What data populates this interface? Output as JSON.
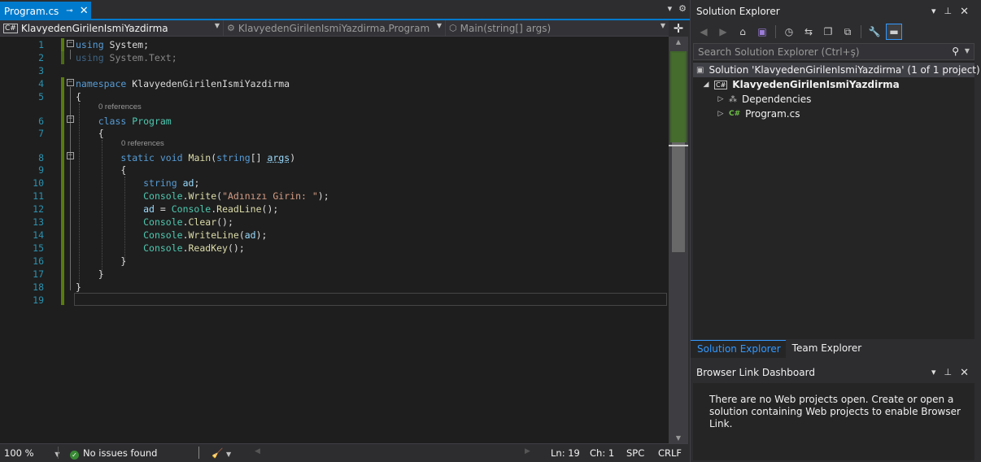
{
  "editor": {
    "tab": {
      "title": "Program.cs",
      "pin_glyph": "⊸",
      "close_glyph": "✕"
    },
    "tab_strip_glyphs": {
      "overflow": "▾",
      "settings": "⚙"
    },
    "nav": {
      "project": "KlavyedenGirilenIsmiYazdirma",
      "class": "KlavyedenGirilenIsmiYazdirma.Program",
      "member": "Main(string[] args)"
    },
    "codelens": "0 references",
    "lines": [
      {
        "n": "1",
        "tokens": [
          [
            "kw",
            "using"
          ],
          [
            "",
            " System;"
          ]
        ]
      },
      {
        "n": "2",
        "tokens": [
          [
            "kw faded",
            "using"
          ],
          [
            "faded",
            " System.Text;"
          ]
        ]
      },
      {
        "n": "3",
        "tokens": []
      },
      {
        "n": "4",
        "tokens": [
          [
            "kw",
            "namespace"
          ],
          [
            "",
            " KlavyedenGirilenIsmiYazdirma"
          ]
        ]
      },
      {
        "n": "5",
        "tokens": [
          [
            "",
            "{"
          ]
        ]
      },
      {
        "n": "6",
        "tokens": [
          [
            "",
            "    "
          ],
          [
            "kw",
            "class"
          ],
          [
            "",
            " "
          ],
          [
            "ty",
            "Program"
          ]
        ]
      },
      {
        "n": "7",
        "tokens": [
          [
            "",
            "    {"
          ]
        ]
      },
      {
        "n": "8",
        "tokens": [
          [
            "",
            "        "
          ],
          [
            "kw",
            "static"
          ],
          [
            "",
            " "
          ],
          [
            "kw",
            "void"
          ],
          [
            "",
            " "
          ],
          [
            "mt",
            "Main"
          ],
          [
            "",
            "("
          ],
          [
            "kw",
            "string"
          ],
          [
            "",
            "[] "
          ],
          [
            "pm",
            "args"
          ],
          [
            "",
            ")"
          ]
        ]
      },
      {
        "n": "9",
        "tokens": [
          [
            "",
            "        {"
          ]
        ]
      },
      {
        "n": "10",
        "tokens": [
          [
            "",
            "            "
          ],
          [
            "kw",
            "string"
          ],
          [
            "",
            " "
          ],
          [
            "vr",
            "ad"
          ],
          [
            "",
            ";"
          ]
        ]
      },
      {
        "n": "11",
        "tokens": [
          [
            "",
            "            "
          ],
          [
            "ty",
            "Console"
          ],
          [
            "",
            "."
          ],
          [
            "mt",
            "Write"
          ],
          [
            "",
            "("
          ],
          [
            "str",
            "\"Adınızı Girin: \""
          ],
          [
            "",
            ");"
          ]
        ]
      },
      {
        "n": "12",
        "tokens": [
          [
            "",
            "            "
          ],
          [
            "vr",
            "ad"
          ],
          [
            "",
            " = "
          ],
          [
            "ty",
            "Console"
          ],
          [
            "",
            "."
          ],
          [
            "mt",
            "ReadLine"
          ],
          [
            "",
            "();"
          ]
        ]
      },
      {
        "n": "13",
        "tokens": [
          [
            "",
            "            "
          ],
          [
            "ty",
            "Console"
          ],
          [
            "",
            "."
          ],
          [
            "mt",
            "Clear"
          ],
          [
            "",
            "();"
          ]
        ]
      },
      {
        "n": "14",
        "tokens": [
          [
            "",
            "            "
          ],
          [
            "ty",
            "Console"
          ],
          [
            "",
            "."
          ],
          [
            "mt",
            "WriteLine"
          ],
          [
            "",
            "("
          ],
          [
            "vr",
            "ad"
          ],
          [
            "",
            ");"
          ]
        ]
      },
      {
        "n": "15",
        "tokens": [
          [
            "",
            "            "
          ],
          [
            "ty",
            "Console"
          ],
          [
            "",
            "."
          ],
          [
            "mt",
            "ReadKey"
          ],
          [
            "",
            "();"
          ]
        ]
      },
      {
        "n": "16",
        "tokens": [
          [
            "",
            "        }"
          ]
        ]
      },
      {
        "n": "17",
        "tokens": [
          [
            "",
            "    }"
          ]
        ]
      },
      {
        "n": "18",
        "tokens": [
          [
            "",
            "}"
          ]
        ]
      },
      {
        "n": "19",
        "tokens": []
      }
    ],
    "status": {
      "zoom": "100 %",
      "issues": "No issues found",
      "line": "Ln: 19",
      "col": "Ch: 1",
      "whitespace": "SPC",
      "eol": "CRLF"
    }
  },
  "solution_explorer": {
    "title": "Solution Explorer",
    "search_placeholder": "Search Solution Explorer (Ctrl+ş)",
    "solution": "Solution 'KlavyedenGirilenIsmiYazdirma' (1 of 1 project)",
    "project": "KlavyedenGirilenIsmiYazdirma",
    "items": [
      "Dependencies",
      "Program.cs"
    ],
    "tabs": [
      "Solution Explorer",
      "Team Explorer"
    ]
  },
  "browser_link": {
    "title": "Browser Link Dashboard",
    "message": "There are no Web projects open. Create or open a solution containing Web projects to enable Browser Link."
  },
  "colors": {
    "accent": "#007acc",
    "keyword": "#569cd6",
    "type": "#4ec9b0",
    "string": "#d69d85",
    "method": "#dcdcaa",
    "line_number": "#2b91af",
    "change_bar": "#587c0c"
  }
}
